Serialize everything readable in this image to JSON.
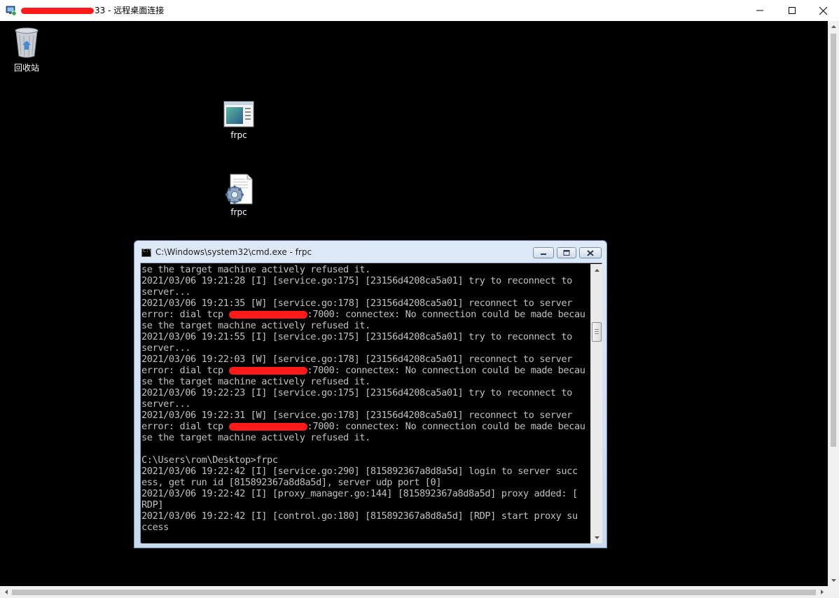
{
  "rdp_window": {
    "title_prefix": "",
    "title_visible_suffix": "33 - 远程桌面连接",
    "icons": {
      "app": "remote-desktop-icon",
      "minimize": "minimize-icon",
      "maximize": "maximize-icon",
      "close": "close-icon"
    }
  },
  "desktop": {
    "icons": [
      {
        "label": "回收站",
        "icon": "recycle-bin-icon"
      },
      {
        "label": "frpc",
        "icon": "application-exe-icon"
      },
      {
        "label": "frpc",
        "icon": "config-file-icon"
      }
    ]
  },
  "cmd_window": {
    "title": "C:\\Windows\\system32\\cmd.exe - frpc",
    "lines": [
      {
        "text": "se the target machine actively refused it."
      },
      {
        "text": "2021/03/06 19:21:28 [I] [service.go:175] [23156d4208ca5a01] try to reconnect to"
      },
      {
        "text": "server..."
      },
      {
        "text": "2021/03/06 19:21:35 [W] [service.go:178] [23156d4208ca5a01] reconnect to server"
      },
      {
        "text_before": "error: dial tcp ",
        "text_after": ":7000: connectex: No connection could be made becau",
        "redacted": true
      },
      {
        "text": "se the target machine actively refused it."
      },
      {
        "text": "2021/03/06 19:21:55 [I] [service.go:175] [23156d4208ca5a01] try to reconnect to"
      },
      {
        "text": "server..."
      },
      {
        "text": "2021/03/06 19:22:03 [W] [service.go:178] [23156d4208ca5a01] reconnect to server"
      },
      {
        "text_before": "error: dial tcp ",
        "text_after": ":7000: connectex: No connection could be made becau",
        "redacted": true
      },
      {
        "text": "se the target machine actively refused it."
      },
      {
        "text": "2021/03/06 19:22:23 [I] [service.go:175] [23156d4208ca5a01] try to reconnect to"
      },
      {
        "text": "server..."
      },
      {
        "text": "2021/03/06 19:22:31 [W] [service.go:178] [23156d4208ca5a01] reconnect to server"
      },
      {
        "text_before": "error: dial tcp ",
        "text_after": ":7000: connectex: No connection could be made becau",
        "redacted": true
      },
      {
        "text": "se the target machine actively refused it."
      },
      {
        "text": ""
      },
      {
        "text": "C:\\Users\\rom\\Desktop>frpc"
      },
      {
        "text": "2021/03/06 19:22:42 [I] [service.go:290] [815892367a8d8a5d] login to server succ"
      },
      {
        "text": "ess, get run id [815892367a8d8a5d], server udp port [0]"
      },
      {
        "text": "2021/03/06 19:22:42 [I] [proxy_manager.go:144] [815892367a8d8a5d] proxy added: ["
      },
      {
        "text": "RDP]"
      },
      {
        "text": "2021/03/06 19:22:42 [I] [control.go:180] [815892367a8d8a5d] [RDP] start proxy su"
      },
      {
        "text": "ccess"
      }
    ]
  },
  "colors": {
    "desktop_bg": "#000000",
    "console_fg": "#c0c0c0",
    "redaction": "#ff1a1a"
  }
}
